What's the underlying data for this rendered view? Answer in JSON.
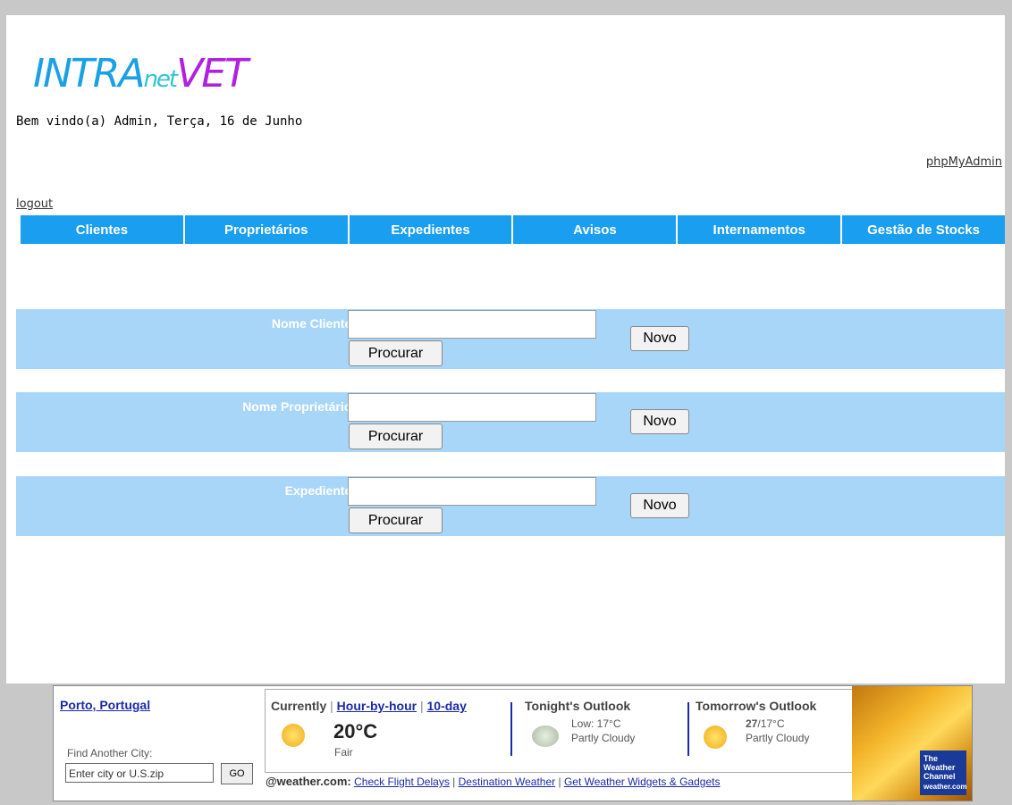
{
  "logo": {
    "part1": "INTRA",
    "part2": "net",
    "part3": "VET"
  },
  "header": {
    "welcome": "Bem vindo(a) Admin, Terça, 16 de Junho",
    "phpmyadmin": "phpMyAdmin",
    "logout": "logout"
  },
  "nav": {
    "tabs": [
      "Clientes",
      "Proprietários",
      "Expedientes",
      "Avisos",
      "Internamentos",
      "Gestão de Stocks"
    ]
  },
  "search": [
    {
      "label": "Nome Cliente:",
      "value": "",
      "search_btn": "Procurar",
      "new_btn": "Novo"
    },
    {
      "label": "Nome Proprietário:",
      "value": "",
      "search_btn": "Procurar",
      "new_btn": "Novo"
    },
    {
      "label": "Expediente:",
      "value": "",
      "search_btn": "Procurar",
      "new_btn": "Novo"
    }
  ],
  "weather": {
    "city": "Porto, Portugal",
    "find_label": "Find Another City:",
    "find_placeholder": "Enter city or U.S.zip",
    "go": "GO",
    "currently": "Currently",
    "hour_by_hour": "Hour-by-hour",
    "ten_day": "10-day",
    "current_temp": "20°C",
    "current_cond": "Fair",
    "tonight_title": "Tonight's Outlook",
    "tonight_low": "Low: 17°C",
    "tonight_cond": "Partly Cloudy",
    "tomorrow_title": "Tomorrow's Outlook",
    "tomorrow_high": "27",
    "tomorrow_low": "/17°C",
    "tomorrow_cond": "Partly Cloudy",
    "brand": "@weather.com:",
    "link1": "Check Flight Delays",
    "link2": "Destination Weather",
    "link3": "Get Weather Widgets & Gadgets",
    "promo_badge": "The Weather Channel",
    "promo_site": "weather.com"
  }
}
